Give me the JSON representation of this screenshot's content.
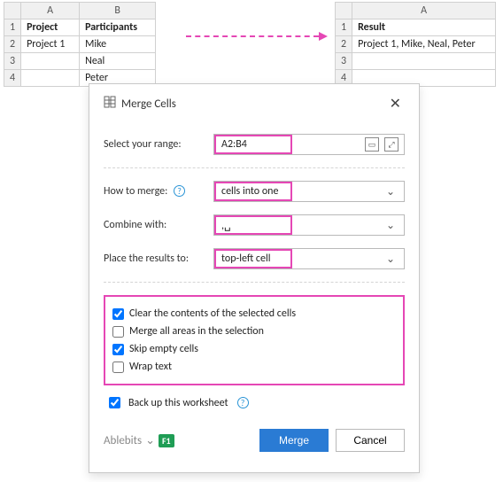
{
  "sheetLeft": {
    "cols": [
      "A",
      "B"
    ],
    "rows": [
      "1",
      "2",
      "3",
      "4"
    ],
    "header": {
      "project": "Project",
      "participants": "Participants"
    },
    "data": {
      "project": "Project 1",
      "p1": "Mike",
      "p2": "Neal",
      "p3": "Peter"
    }
  },
  "sheetRight": {
    "cols": [
      "A"
    ],
    "rows": [
      "1",
      "2",
      "3",
      "4"
    ],
    "header": {
      "result": "Result"
    },
    "data": {
      "merged": "Project 1, Mike, Neal, Peter"
    }
  },
  "dialog": {
    "title": "Merge Cells",
    "labels": {
      "range": "Select your range:",
      "howToMerge": "How to merge:",
      "combineWith": "Combine with:",
      "placeResults": "Place the results to:"
    },
    "values": {
      "range": "A2:B4",
      "howToMerge": "cells into one",
      "combineWith": ",␣",
      "placeResults": "top-left cell"
    },
    "checks": {
      "clear": "Clear the contents of the selected cells",
      "mergeAreas": "Merge all areas in the selection",
      "skipEmpty": "Skip empty cells",
      "wrapText": "Wrap text",
      "backup": "Back up this worksheet"
    },
    "brand": {
      "name": "Ablebits",
      "badge": "F1"
    },
    "buttons": {
      "merge": "Merge",
      "cancel": "Cancel"
    }
  }
}
